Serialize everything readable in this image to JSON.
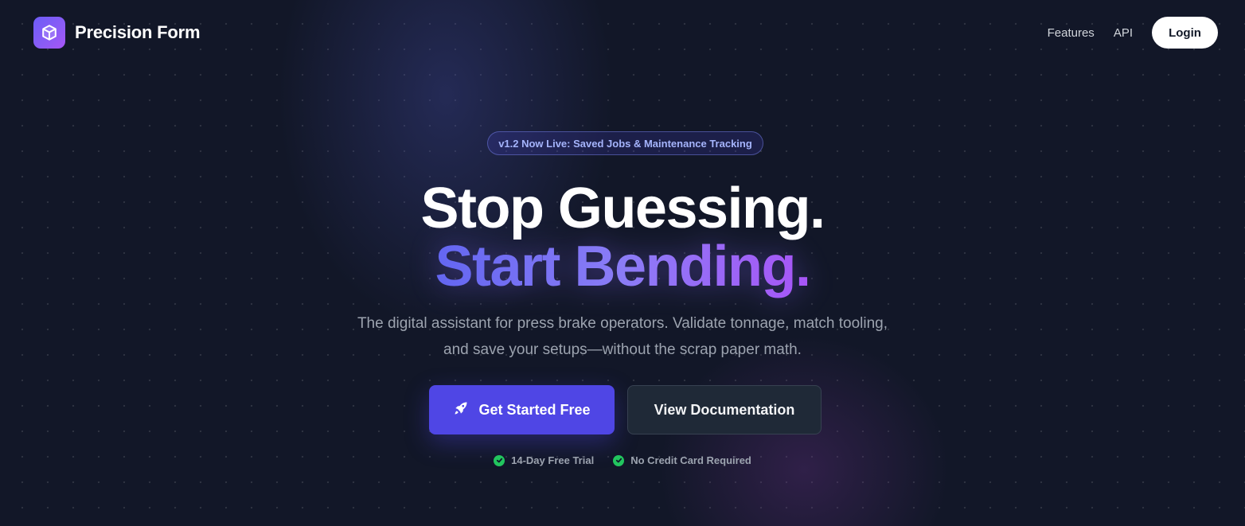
{
  "nav": {
    "brand": "Precision Form",
    "logo_icon": "cube-icon",
    "links": [
      "Features",
      "API"
    ],
    "login_label": "Login"
  },
  "hero": {
    "badge": "v1.2 Now Live: Saved Jobs & Maintenance Tracking",
    "headline_line1": "Stop Guessing.",
    "headline_line2": "Start Bending.",
    "subtitle": "The digital assistant for press brake operators. Validate tonnage, match tooling, and save your setups—without the scrap paper math.",
    "primary_cta": "Get Started Free",
    "primary_cta_icon": "rocket-icon",
    "secondary_cta": "View Documentation",
    "perks": [
      "14-Day Free Trial",
      "No Credit Card Required"
    ],
    "perk_icon": "check-circle-icon"
  },
  "colors": {
    "background": "#121728",
    "accent": "#4f46e5",
    "gradient_start": "#6366f1",
    "gradient_end": "#a855f7",
    "success": "#22c55e"
  }
}
